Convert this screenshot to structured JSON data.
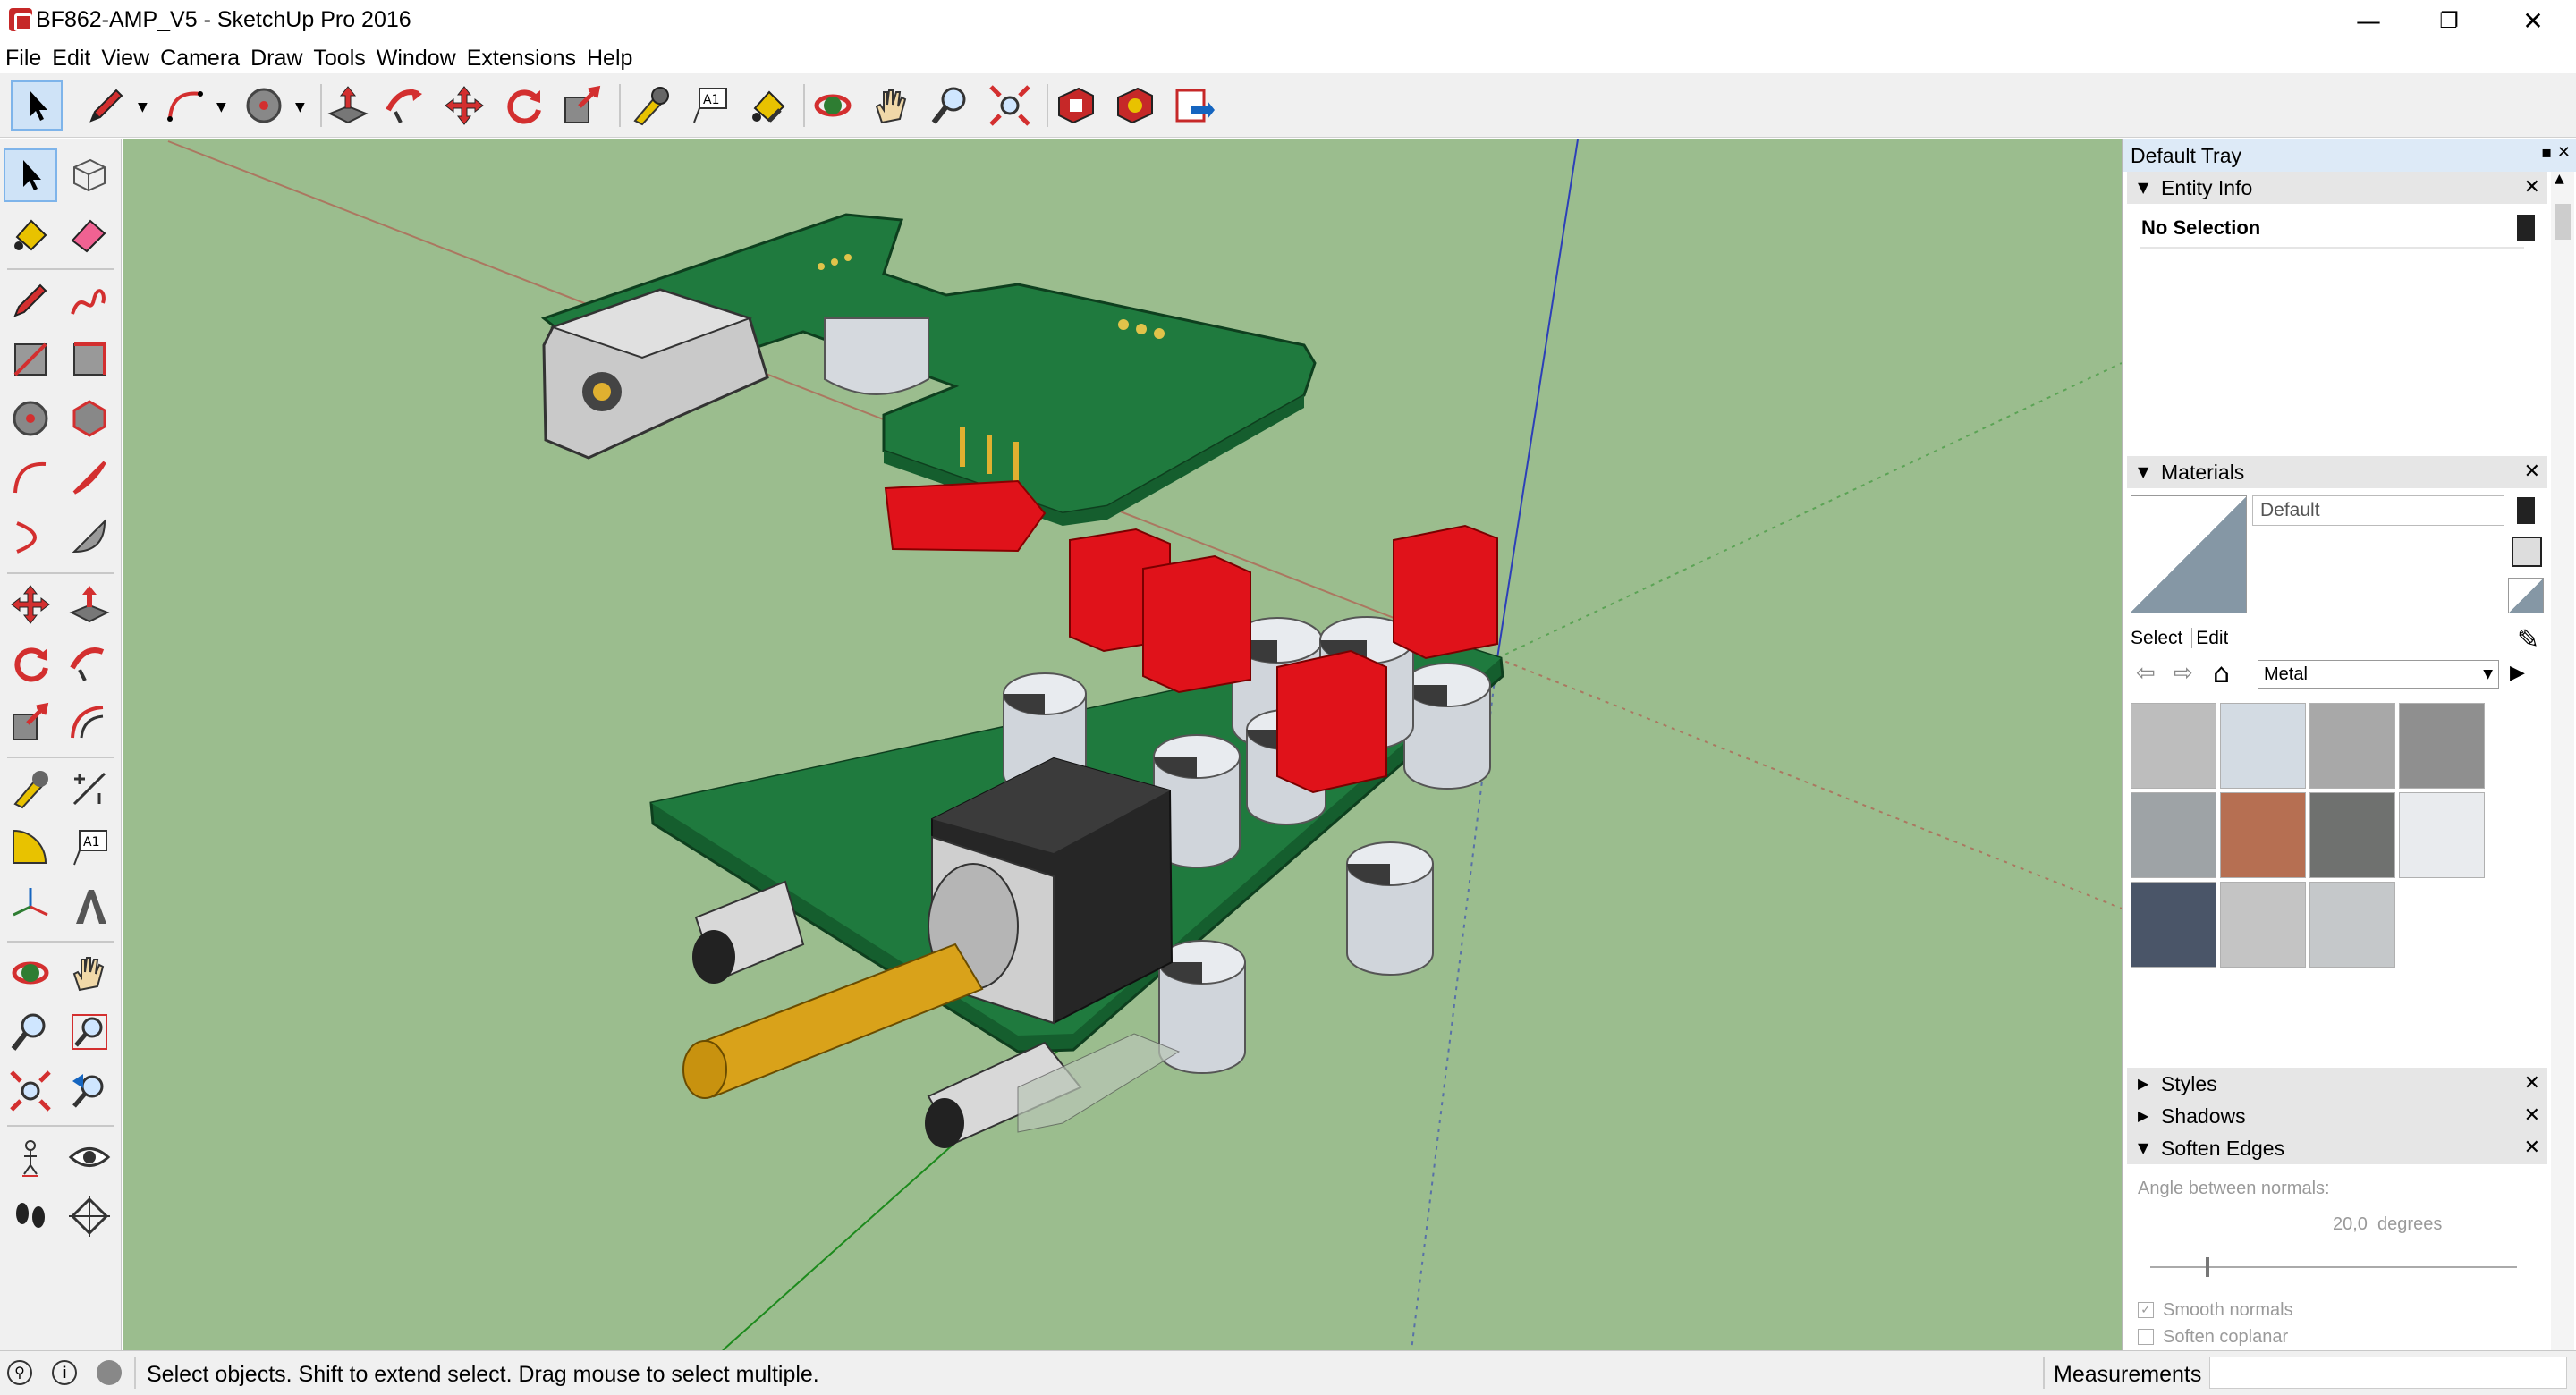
{
  "window": {
    "title": "BF862-AMP_V5 - SketchUp Pro 2016",
    "minimize": "—",
    "restore": "❐",
    "close": "✕"
  },
  "menu": [
    "File",
    "Edit",
    "View",
    "Camera",
    "Draw",
    "Tools",
    "Window",
    "Extensions",
    "Help"
  ],
  "toolbar_icons": [
    "select-arrow",
    "pencil-line",
    "arc",
    "circle-tape",
    "push-pull",
    "follow-me",
    "move",
    "rotate",
    "scale",
    "tape-measure",
    "text-label",
    "paint-bucket",
    "orbit",
    "pan",
    "zoom",
    "zoom-extents",
    "warehouse",
    "extension-warehouse",
    "send-to-layout"
  ],
  "left_tool_icons": [
    "select",
    "component",
    "paint-bucket",
    "eraser",
    "line",
    "freehand",
    "rectangle",
    "rotated-rectangle",
    "circle",
    "polygon",
    "arc",
    "two-point-arc",
    "three-point-arc",
    "pie",
    "move",
    "push-pull",
    "rotate",
    "follow-me",
    "scale",
    "offset",
    "tape-measure",
    "dimension",
    "protractor",
    "text",
    "axes",
    "3d-text",
    "orbit",
    "pan",
    "zoom",
    "zoom-window",
    "zoom-extents",
    "previous",
    "position-camera",
    "look-around",
    "walk",
    "section-plane"
  ],
  "tray": {
    "title": "Default Tray",
    "entity_info": {
      "title": "Entity Info",
      "selection": "No Selection"
    },
    "materials": {
      "title": "Materials",
      "material_name": "Default",
      "tab_select": "Select",
      "tab_edit": "Edit",
      "library": "Metal",
      "swatch_colors": [
        "#bdbdbd",
        "#d3dbe3",
        "#a8a8a8",
        "#8f8f8f",
        "#9ea3a6",
        "#b66f52",
        "#6f716f",
        "#e9ebee",
        "#4a5568",
        "#c4c4c4",
        "#c5c8ca"
      ]
    },
    "styles": {
      "title": "Styles"
    },
    "shadows": {
      "title": "Shadows"
    },
    "soften_edges": {
      "title": "Soften Edges",
      "angle_label": "Angle between normals:",
      "angle_value": "20,0  degrees",
      "smooth_normals": "Smooth normals",
      "soften_coplanar": "Soften coplanar",
      "smooth_normals_checked": true,
      "soften_coplanar_checked": false,
      "slider_fraction": 0.15
    }
  },
  "status": {
    "message": "Select objects. Shift to extend select. Drag mouse to select multiple.",
    "measurements_label": "Measurements"
  },
  "colors": {
    "viewport_bg": "#9bbd8e",
    "pcb_green": "#1f7a3e",
    "capacitor": "#d0d5db",
    "relay_red": "#e0121a",
    "knob_gold": "#d9a21a",
    "pot_black": "#262626"
  }
}
